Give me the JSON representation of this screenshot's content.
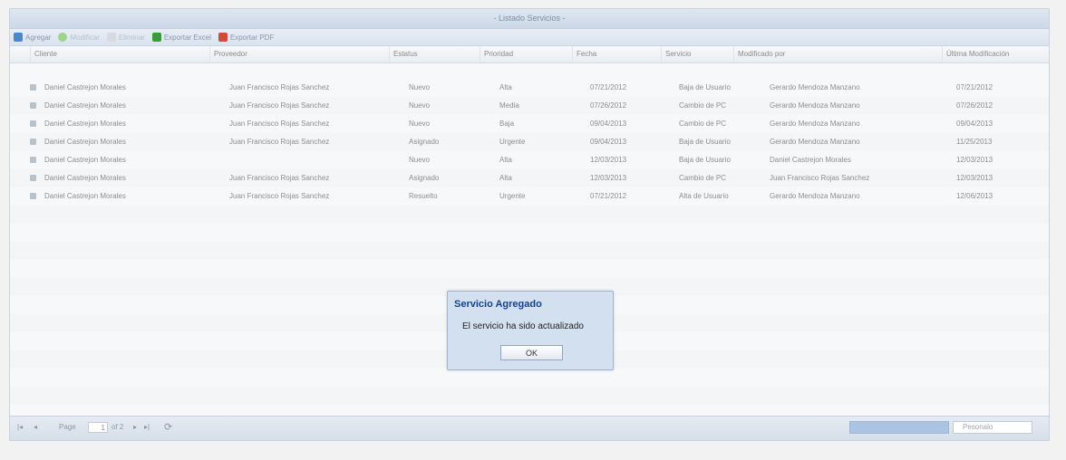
{
  "panel": {
    "title": "- Listado Servicios -"
  },
  "toolbar": {
    "add_label": "Agregar",
    "edit_label": "Modificar",
    "delete_label": "Eliminar",
    "export_excel_label": "Exportar Excel",
    "export_pdf_label": "Exportar PDF"
  },
  "grid": {
    "columns": [
      "Cliente",
      "Proveedor",
      "Estatus",
      "Prioridad",
      "Fecha",
      "Servicio",
      "Modificado por",
      "Última Modificación"
    ],
    "rows": [
      [
        "Daniel Castrejon Morales",
        "Juan Francisco Rojas Sanchez",
        "Nuevo",
        "Alta",
        "07/21/2012",
        "Baja de Usuario",
        "Gerardo Mendoza Manzano",
        "07/21/2012"
      ],
      [
        "Daniel Castrejon Morales",
        "Juan Francisco Rojas Sanchez",
        "Nuevo",
        "Media",
        "07/26/2012",
        "Cambio de PC",
        "Gerardo Mendoza Manzano",
        "07/26/2012"
      ],
      [
        "Daniel Castrejon Morales",
        "Juan Francisco Rojas Sanchez",
        "Nuevo",
        "Baja",
        "09/04/2013",
        "Cambio de PC",
        "Gerardo Mendoza Manzano",
        "09/04/2013"
      ],
      [
        "Daniel Castrejon Morales",
        "Juan Francisco Rojas Sanchez",
        "Asignado",
        "Urgente",
        "09/04/2013",
        "Baja de Usuario",
        "Gerardo Mendoza Manzano",
        "11/25/2013"
      ],
      [
        "Daniel Castrejon Morales",
        "",
        "Nuevo",
        "Alta",
        "12/03/2013",
        "Baja de Usuario",
        "Daniel Castrejon Morales",
        "12/03/2013"
      ],
      [
        "Daniel Castrejon Morales",
        "Juan Francisco Rojas Sanchez",
        "Asignado",
        "Alta",
        "12/03/2013",
        "Cambio de PC",
        "Juan Francisco Rojas Sanchez",
        "12/03/2013"
      ],
      [
        "Daniel Castrejon Morales",
        "Juan Francisco Rojas Sanchez",
        "Resuelto",
        "Urgente",
        "07/21/2012",
        "Alta de Usuario",
        "Gerardo Mendoza Manzano",
        "12/06/2013"
      ]
    ]
  },
  "pager": {
    "page_label": "Page",
    "page_value": "1",
    "of_label": "of 2",
    "search_placeholder": "Pesonalo"
  },
  "dialog": {
    "title": "Servicio Agregado",
    "message": "El servicio ha sido actualizado",
    "ok_label": "OK"
  },
  "colors": {
    "dialog_title": "#15428b",
    "add_icon": "#4f86c6",
    "edit_icon": "#6cbf4a",
    "excel_icon": "#3b9a3b",
    "pdf_icon": "#d04a3a"
  }
}
